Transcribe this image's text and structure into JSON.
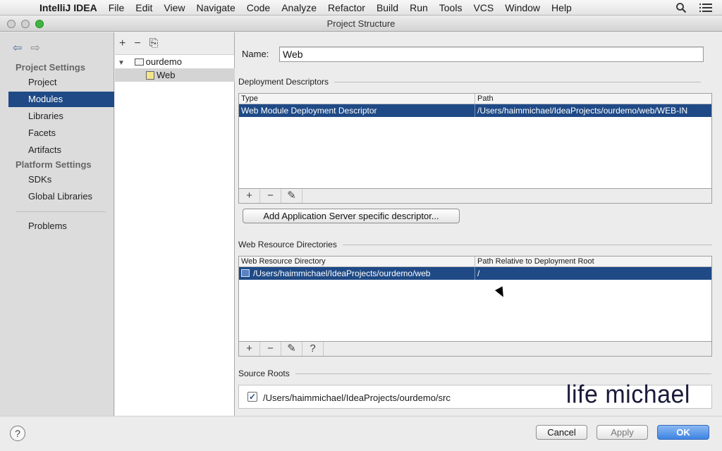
{
  "menubar": {
    "apple_glyph": "",
    "items": [
      "IntelliJ IDEA",
      "File",
      "Edit",
      "View",
      "Navigate",
      "Code",
      "Analyze",
      "Refactor",
      "Build",
      "Run",
      "Tools",
      "VCS",
      "Window",
      "Help"
    ],
    "icons": [
      "search-icon",
      "list-icon"
    ]
  },
  "window": {
    "title": "Project Structure"
  },
  "nav": {
    "project_settings": "Project Settings",
    "items_project": [
      "Project",
      "Modules",
      "Libraries",
      "Facets",
      "Artifacts"
    ],
    "platform_settings": "Platform Settings",
    "items_platform": [
      "SDKs",
      "Global Libraries"
    ],
    "problems": "Problems",
    "selected": "Modules"
  },
  "tree": {
    "toolbar": [
      "+",
      "−",
      "⎘"
    ],
    "root": "ourdemo",
    "child": "Web"
  },
  "main": {
    "name_label": "Name:",
    "name_value": "Web",
    "deploy_title": "Deployment Descriptors",
    "deploy_headers": [
      "Type",
      "Path"
    ],
    "deploy_row": [
      "Web Module Deployment Descriptor",
      "/Users/haimmichael/IdeaProjects/ourdemo/web/WEB-IN"
    ],
    "add_server_btn": "Add Application Server specific descriptor...",
    "webres_title": "Web Resource Directories",
    "webres_headers": [
      "Web Resource Directory",
      "Path Relative to Deployment Root"
    ],
    "webres_row": [
      "/Users/haimmichael/IdeaProjects/ourdemo/web",
      "/"
    ],
    "toolbar_add": "+",
    "toolbar_remove": "−",
    "toolbar_edit": "✎",
    "toolbar_help": "?",
    "source_roots_title": "Source Roots",
    "source_root_path": "/Users/haimmichael/IdeaProjects/ourdemo/src",
    "checkmark": "✓",
    "watermark": "life michael"
  },
  "footer": {
    "help": "?",
    "cancel": "Cancel",
    "apply": "Apply",
    "ok": "OK"
  }
}
